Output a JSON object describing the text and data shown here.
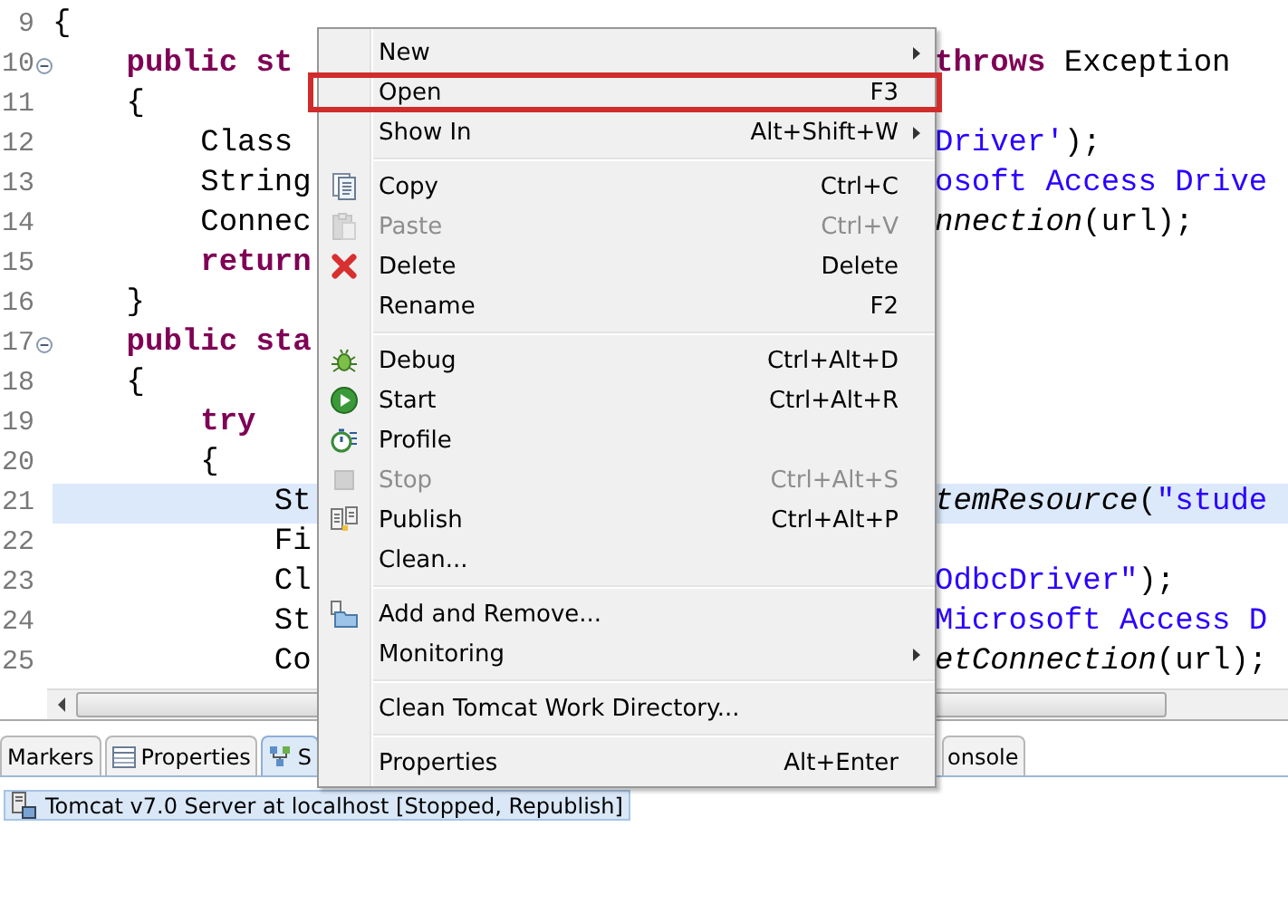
{
  "editor": {
    "lines": [
      {
        "num": "9",
        "fold": false,
        "highlighted": false,
        "left": [
          {
            "text": "{",
            "kind": "plain"
          }
        ]
      },
      {
        "num": "10",
        "fold": true,
        "highlighted": false,
        "left": [
          {
            "text": "    public st",
            "kind": "keyword"
          }
        ],
        "right": [
          {
            "text": "throws",
            "kind": "keyword"
          },
          {
            "text": " Exception",
            "kind": "plain"
          }
        ]
      },
      {
        "num": "11",
        "fold": false,
        "highlighted": false,
        "left": [
          {
            "text": "    {",
            "kind": "plain"
          }
        ]
      },
      {
        "num": "12",
        "fold": false,
        "highlighted": false,
        "left": [
          {
            "text": "        Class",
            "kind": "plain"
          }
        ],
        "right": [
          {
            "text": "Driver'",
            "kind": "string"
          },
          {
            "text": ");",
            "kind": "plain"
          }
        ]
      },
      {
        "num": "13",
        "fold": false,
        "highlighted": false,
        "left": [
          {
            "text": "        String",
            "kind": "plain"
          }
        ],
        "right": [
          {
            "text": "osoft Access Drive",
            "kind": "string"
          }
        ]
      },
      {
        "num": "14",
        "fold": false,
        "highlighted": false,
        "left": [
          {
            "text": "        Connec",
            "kind": "plain"
          }
        ],
        "right": [
          {
            "text": "nnection",
            "kind": "italic"
          },
          {
            "text": "(url);",
            "kind": "plain"
          }
        ]
      },
      {
        "num": "15",
        "fold": false,
        "highlighted": false,
        "left": [
          {
            "text": "        return",
            "kind": "keyword"
          }
        ]
      },
      {
        "num": "16",
        "fold": false,
        "highlighted": false,
        "left": [
          {
            "text": "    }",
            "kind": "plain"
          }
        ]
      },
      {
        "num": "17",
        "fold": true,
        "highlighted": false,
        "left": [
          {
            "text": "    public sta",
            "kind": "keyword"
          }
        ]
      },
      {
        "num": "18",
        "fold": false,
        "highlighted": false,
        "left": [
          {
            "text": "    {",
            "kind": "plain"
          }
        ]
      },
      {
        "num": "19",
        "fold": false,
        "highlighted": false,
        "left": [
          {
            "text": "        try",
            "kind": "keyword"
          }
        ]
      },
      {
        "num": "20",
        "fold": false,
        "highlighted": false,
        "left": [
          {
            "text": "        {",
            "kind": "plain"
          }
        ]
      },
      {
        "num": "21",
        "fold": false,
        "highlighted": true,
        "left": [
          {
            "text": "            St",
            "kind": "plain"
          }
        ],
        "right": [
          {
            "text": "temResource",
            "kind": "italic"
          },
          {
            "text": "(",
            "kind": "plain"
          },
          {
            "text": "\"stude",
            "kind": "string"
          }
        ]
      },
      {
        "num": "22",
        "fold": false,
        "highlighted": false,
        "left": [
          {
            "text": "            Fi",
            "kind": "plain"
          }
        ]
      },
      {
        "num": "23",
        "fold": false,
        "highlighted": false,
        "left": [
          {
            "text": "            Cl",
            "kind": "plain"
          }
        ],
        "right": [
          {
            "text": "OdbcDriver\"",
            "kind": "string"
          },
          {
            "text": ");",
            "kind": "plain"
          }
        ]
      },
      {
        "num": "24",
        "fold": false,
        "highlighted": false,
        "left": [
          {
            "text": "            St",
            "kind": "plain"
          }
        ],
        "right": [
          {
            "text": "Microsoft Access D",
            "kind": "string"
          }
        ]
      },
      {
        "num": "25",
        "fold": false,
        "highlighted": false,
        "left": [
          {
            "text": "            Co",
            "kind": "plain"
          }
        ],
        "right": [
          {
            "text": "etConnection",
            "kind": "italic"
          },
          {
            "text": "(url);",
            "kind": "plain"
          }
        ]
      }
    ]
  },
  "context_menu": {
    "items": [
      {
        "kind": "item",
        "label": "New",
        "submenu": true,
        "disabled": false,
        "annotated": false
      },
      {
        "kind": "item",
        "label": "Open",
        "shortcut": "F3",
        "submenu": false,
        "disabled": false,
        "annotated": true
      },
      {
        "kind": "item",
        "label": "Show In",
        "shortcut": "Alt+Shift+W",
        "submenu": true,
        "disabled": false,
        "annotated": false
      },
      {
        "kind": "separator"
      },
      {
        "kind": "item",
        "label": "Copy",
        "shortcut": "Ctrl+C",
        "submenu": false,
        "disabled": false,
        "annotated": false
      },
      {
        "kind": "item",
        "label": "Paste",
        "shortcut": "Ctrl+V",
        "submenu": false,
        "disabled": true,
        "annotated": false
      },
      {
        "kind": "item",
        "label": "Delete",
        "shortcut": "Delete",
        "submenu": false,
        "disabled": false,
        "annotated": false
      },
      {
        "kind": "item",
        "label": "Rename",
        "shortcut": "F2",
        "submenu": false,
        "disabled": false,
        "annotated": false
      },
      {
        "kind": "separator"
      },
      {
        "kind": "item",
        "label": "Debug",
        "shortcut": "Ctrl+Alt+D",
        "submenu": false,
        "disabled": false,
        "annotated": false
      },
      {
        "kind": "item",
        "label": "Start",
        "shortcut": "Ctrl+Alt+R",
        "submenu": false,
        "disabled": false,
        "annotated": false
      },
      {
        "kind": "item",
        "label": "Profile",
        "submenu": false,
        "disabled": false,
        "annotated": false
      },
      {
        "kind": "item",
        "label": "Stop",
        "shortcut": "Ctrl+Alt+S",
        "submenu": false,
        "disabled": true,
        "annotated": false
      },
      {
        "kind": "item",
        "label": "Publish",
        "shortcut": "Ctrl+Alt+P",
        "submenu": false,
        "disabled": false,
        "annotated": false
      },
      {
        "kind": "item",
        "label": "Clean...",
        "submenu": false,
        "disabled": false,
        "annotated": false
      },
      {
        "kind": "separator"
      },
      {
        "kind": "item",
        "label": "Add and Remove...",
        "submenu": false,
        "disabled": false,
        "annotated": false
      },
      {
        "kind": "item",
        "label": "Monitoring",
        "submenu": true,
        "disabled": false,
        "annotated": false
      },
      {
        "kind": "separator"
      },
      {
        "kind": "item",
        "label": "Clean Tomcat Work Directory...",
        "submenu": false,
        "disabled": false,
        "annotated": false
      },
      {
        "kind": "separator"
      },
      {
        "kind": "item",
        "label": "Properties",
        "shortcut": "Alt+Enter",
        "submenu": false,
        "disabled": false,
        "annotated": false
      }
    ]
  },
  "bottom_panel": {
    "tabs": [
      {
        "label": "Markers",
        "selected": false
      },
      {
        "label": "Properties",
        "selected": false
      },
      {
        "label": "S",
        "selected": true
      }
    ],
    "hidden_tab": {
      "label": "onsole"
    },
    "servers": [
      {
        "label": "Tomcat v7.0 Server at localhost  [Stopped, Republish]",
        "selected": true
      }
    ]
  }
}
